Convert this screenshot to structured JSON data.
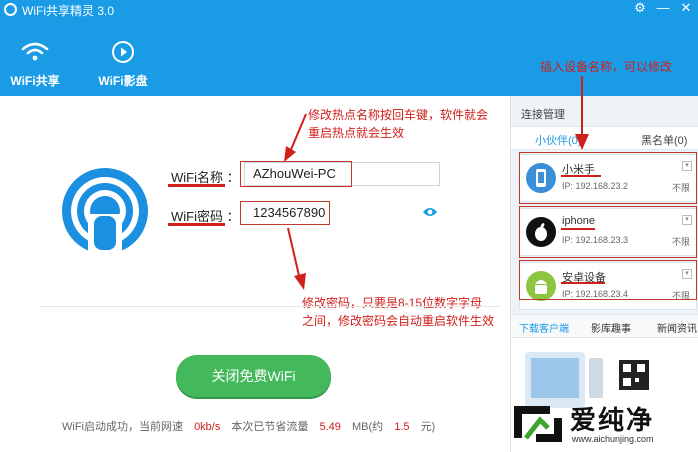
{
  "window": {
    "title": "WiFi共享精灵 3.0",
    "settings_icon": "gear-icon",
    "minimize": "—",
    "close": "✕"
  },
  "nav": {
    "tabs": [
      {
        "label": "WiFi共享",
        "icon": "wifi-icon",
        "active": true
      },
      {
        "label": "WiFi影盘",
        "icon": "play-circle-icon",
        "active": false
      }
    ]
  },
  "form": {
    "ssid_label": "WiFi名称 ：",
    "ssid_value": "AZhouWei-PC",
    "password_label": "WiFi密码 ：",
    "password_value": "1234567890",
    "reveal_icon": "eye-icon"
  },
  "annotations": {
    "ssid_note_line1": "修改热点名称按回车键，软件就会",
    "ssid_note_line2": "重启热点就会生效",
    "password_note_line1": "修改密码，只要是8-15位数字字母",
    "password_note_line2": "之间，修改密码会自动重启软件生效",
    "device_note": "插入设备名称，可以修改"
  },
  "action": {
    "toggle_label": "关闭免费WiFi"
  },
  "status": {
    "prefix": "WiFi启动成功，当前网速",
    "speed": "0kb/s",
    "saved_label": "本次已节省流量",
    "saved_value": "5.49",
    "unit_prefix": "MB(约",
    "money": "1.5",
    "money_unit": "元)"
  },
  "panel": {
    "title": "连接管理",
    "tabs": [
      {
        "label": "小伙伴(0)",
        "active": true
      },
      {
        "label": "黑名单(0)",
        "active": false
      }
    ],
    "devices": [
      {
        "name": "小米手",
        "ip": "IP: 192.168.23.2",
        "limit": "不限",
        "icon": "phone-icon",
        "color": "#3a8fd8"
      },
      {
        "name": "iphone",
        "ip": "IP: 192.168.23.3",
        "limit": "不限",
        "icon": "apple-icon",
        "color": "#111111"
      },
      {
        "name": "安卓设备",
        "ip": "IP: 192.168.23.4",
        "limit": "不限",
        "icon": "android-icon",
        "color": "#8dc540"
      }
    ],
    "bottom_tabs": [
      "下载客户端",
      "影库趣事",
      "新闻资讯"
    ]
  },
  "watermark": {
    "brand": "爱纯净",
    "url": "www.aichunjing.com"
  },
  "colors": {
    "header": "#1a9be6",
    "accent_green": "#43b95b",
    "annotation_red": "#d0201b"
  }
}
